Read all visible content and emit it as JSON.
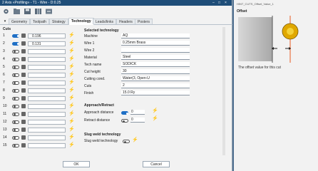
{
  "window": {
    "title": "2 Axis «Profiling» - T1 - Wire - D:0.25"
  },
  "toolbar": {
    "icons": [
      "settings-icon",
      "open-icon",
      "save-icon",
      "library-icon",
      "reset-icon"
    ]
  },
  "tabs": [
    "Geometry",
    "Toolpath",
    "Strategy",
    "Technology",
    "Leads/links",
    "Headers",
    "Posters"
  ],
  "active_tab": "Technology",
  "cuts": {
    "title": "Cuts",
    "rows": [
      {
        "num": "1",
        "on": true,
        "value": "0.196",
        "active": true
      },
      {
        "num": "2",
        "on": true,
        "value": "0.131",
        "active": true
      },
      {
        "num": "3",
        "on": false,
        "value": "",
        "active": false
      },
      {
        "num": "4",
        "on": false,
        "value": "",
        "active": false
      },
      {
        "num": "5",
        "on": false,
        "value": "",
        "active": false
      },
      {
        "num": "6",
        "on": false,
        "value": "",
        "active": false
      },
      {
        "num": "7",
        "on": false,
        "value": "",
        "active": false
      },
      {
        "num": "8",
        "on": false,
        "value": "",
        "active": false
      },
      {
        "num": "9",
        "on": false,
        "value": "",
        "active": false
      },
      {
        "num": "10",
        "on": false,
        "value": "",
        "active": false
      },
      {
        "num": "11",
        "on": false,
        "value": "",
        "active": false
      },
      {
        "num": "12",
        "on": false,
        "value": "",
        "active": false
      },
      {
        "num": "13",
        "on": false,
        "value": "",
        "active": false
      },
      {
        "num": "14",
        "on": false,
        "value": "",
        "active": false
      },
      {
        "num": "15",
        "on": false,
        "value": "",
        "active": false
      }
    ]
  },
  "technology": {
    "title": "Selected technology",
    "fields": [
      {
        "label": "Machine",
        "value": "AQ"
      },
      {
        "label": "Wire 1",
        "value": "0.25mm Brass"
      },
      {
        "label": "Wire 2",
        "value": ""
      },
      {
        "label": "Material",
        "value": "Steel"
      },
      {
        "label": "Tech name",
        "value": "SODICK"
      },
      {
        "label": "Cut height",
        "value": "30"
      },
      {
        "label": "Cutting cond.",
        "value": "Water(3, Open-U"
      },
      {
        "label": "Cuts",
        "value": "2"
      },
      {
        "label": "Finish",
        "value": "15.0 Ry"
      }
    ]
  },
  "approach": {
    "title": "Approach/Retract",
    "approach_label": "Approach distance",
    "approach_value": "0",
    "retract_label": "Retract distance",
    "retract_value": "0"
  },
  "slug": {
    "title": "Slug weld technology",
    "label": "Slug weld technology"
  },
  "buttons": {
    "ok": "OK",
    "cancel": "Cancel"
  },
  "help_panel": {
    "image_name": "HINT_CUTS_Offset_Value_1",
    "title": "Offset",
    "caption": "The offset value for this cut"
  }
}
